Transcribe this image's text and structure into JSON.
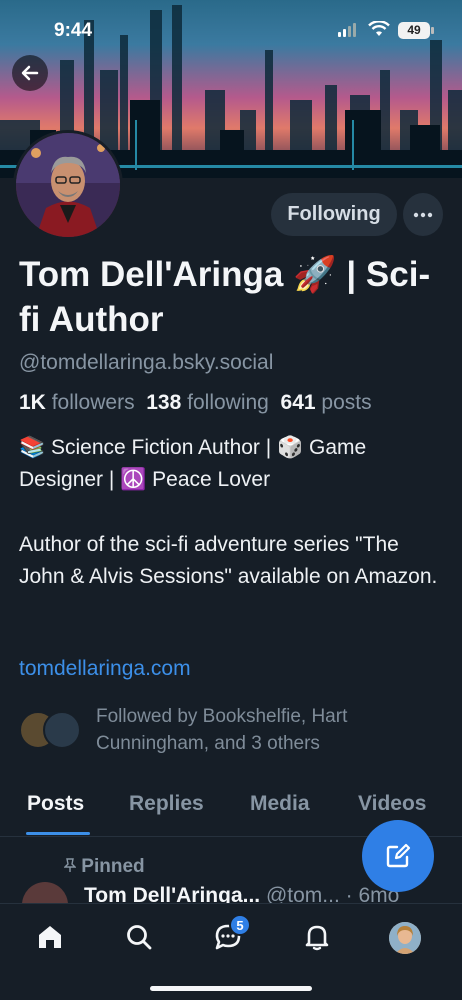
{
  "status_bar": {
    "time": "9:44",
    "battery": "49"
  },
  "profile": {
    "follow_label": "Following",
    "display_name": "Tom Dell'Aringa 🚀 | Sci-fi Author",
    "handle": "@tomdellaringa.bsky.social",
    "followers_count": "1K",
    "followers_label": "followers",
    "following_count": "138",
    "following_label": "following",
    "posts_count": "641",
    "posts_label": "posts",
    "bio_line1": "📚 Science Fiction Author | 🎲 Game Designer | ☮️ Peace Lover",
    "bio_line2": "Author of the sci-fi adventure series \"The John & Alvis Sessions\" available on Amazon.",
    "website": "tomdellaringa.com",
    "followed_by": "Followed by Bookshelfie, Hart Cunningham, and 3 others"
  },
  "tabs": [
    {
      "label": "Posts",
      "active": true
    },
    {
      "label": "Replies",
      "active": false
    },
    {
      "label": "Media",
      "active": false
    },
    {
      "label": "Videos",
      "active": false
    }
  ],
  "post": {
    "pinned_label": "Pinned",
    "author": "Tom Dell'Aringa...",
    "handle": "@tom...",
    "time": "· 6mo"
  },
  "bottom_nav": {
    "items": [
      "home-icon",
      "search-icon",
      "chat-icon",
      "bell-icon",
      "profile-avatar"
    ],
    "chat_badge": "5"
  },
  "colors": {
    "accent": "#2f7fe6",
    "link": "#3c8fe8",
    "background": "#161e27"
  }
}
